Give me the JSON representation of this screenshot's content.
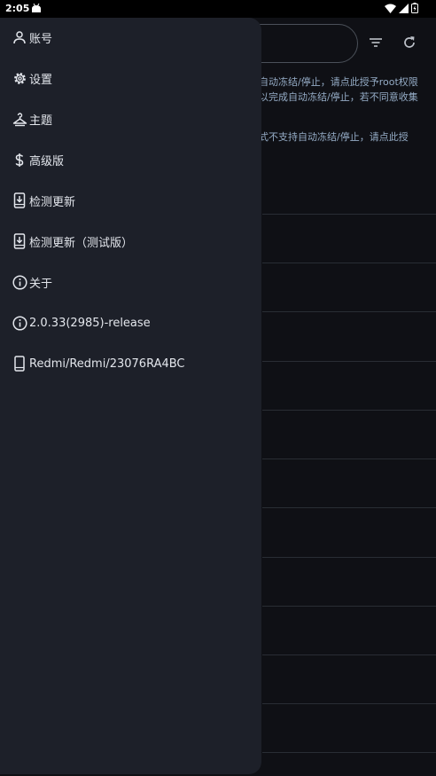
{
  "status_bar": {
    "time": "2:05"
  },
  "background_app": {
    "notice_lines": [
      "自动冻结/停止，请点此授予root权限",
      "以完成自动冻结/停止，若不同意收集",
      "式不支持自动冻结/停止，请点此授"
    ]
  },
  "drawer": {
    "items": [
      {
        "label": "账号",
        "icon": "person-icon"
      },
      {
        "label": "设置",
        "icon": "gear-icon"
      },
      {
        "label": "主题",
        "icon": "hanger-icon"
      },
      {
        "label": "高级版",
        "icon": "dollar-icon"
      },
      {
        "label": "检测更新",
        "icon": "phone-download-icon"
      },
      {
        "label": "检测更新（测试版）",
        "icon": "phone-download-icon"
      },
      {
        "label": "关于",
        "icon": "info-icon"
      },
      {
        "label": "2.0.33(2985)-release",
        "icon": "info-icon"
      },
      {
        "label": "Redmi/Redmi/23076RA4BC",
        "icon": "phone-icon"
      }
    ]
  },
  "colors": {
    "background": "#101217",
    "drawer": "#1d2029",
    "notice_text": "#9fb7d3",
    "text": "#e3e6ec"
  }
}
